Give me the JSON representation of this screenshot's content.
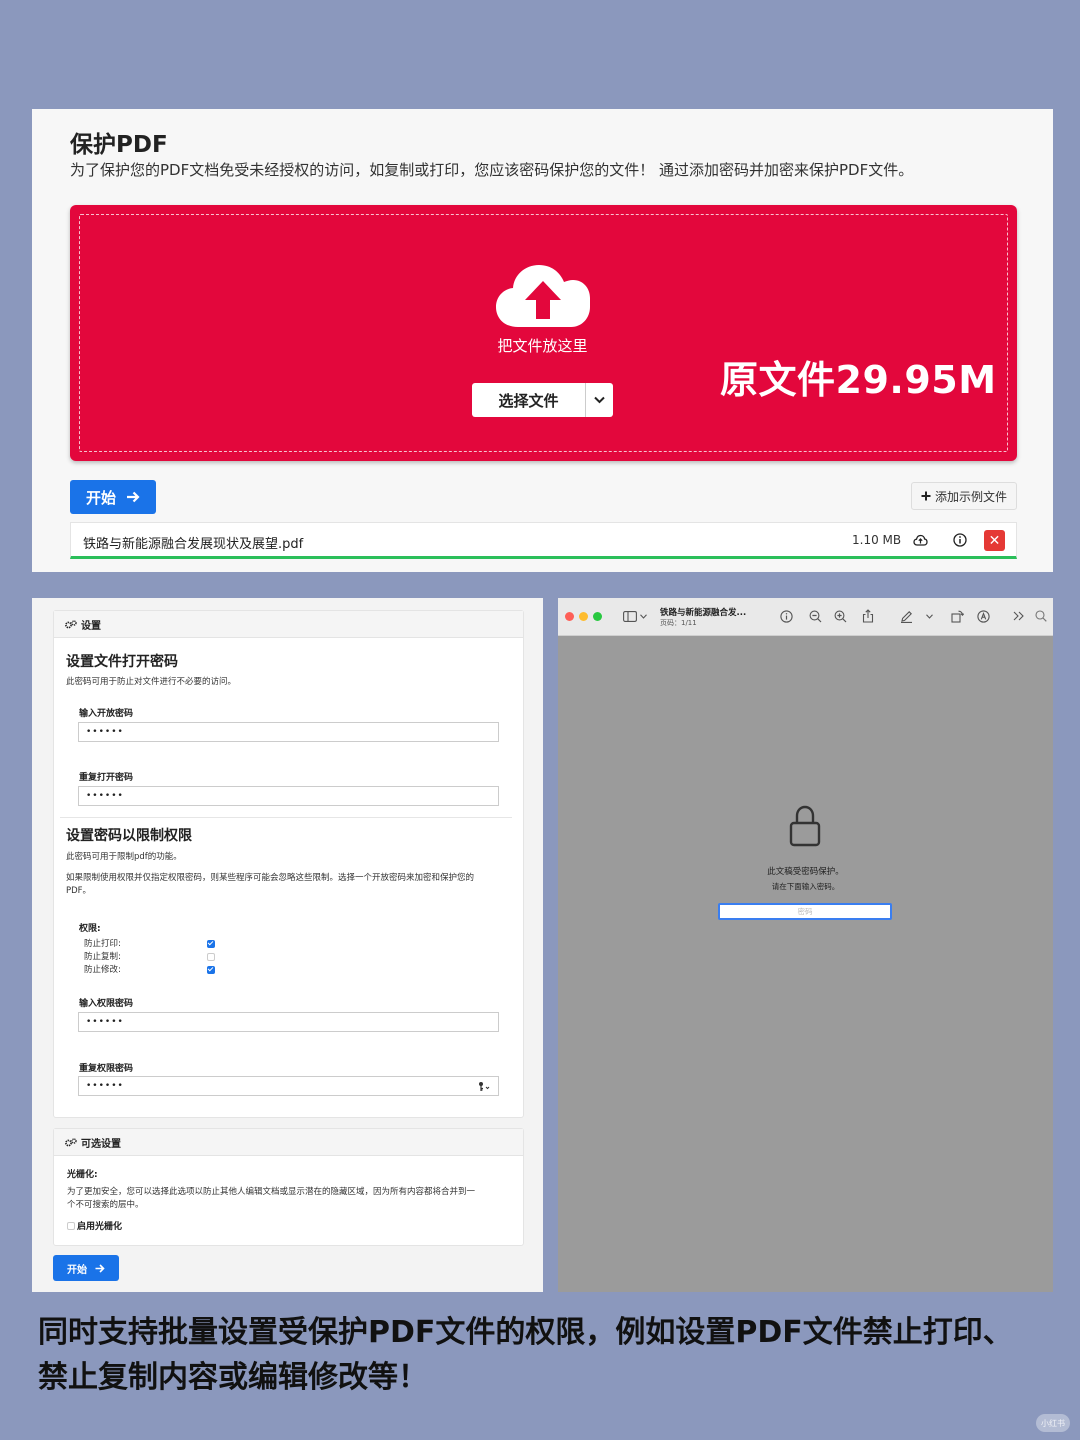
{
  "top": {
    "title": "保护PDF",
    "description": "为了保护您的PDF文档免受未经授权的访问，如复制或打印，您应该密码保护您的文件！ 通过添加密码并加密来保护PDF文件。",
    "drop_text": "把文件放这里",
    "select_button": "选择文件",
    "overlay_text": "原文件29.95M",
    "start_button": "开始",
    "add_sample_button": "添加示例文件",
    "file": {
      "name": "铁路与新能源融合发展现状及展望.pdf",
      "size": "1.10 MB",
      "progress": 1.0
    },
    "colors": {
      "dropzone": "#e3073c",
      "primary": "#1a73e8",
      "progress": "#2bbf5a",
      "remove": "#e53935"
    }
  },
  "settings": {
    "header": "设置",
    "open_password": {
      "title": "设置文件打开密码",
      "desc": "此密码可用于防止对文件进行不必要的访问。",
      "input_label": "输入开放密码",
      "input_value": "••••••",
      "repeat_label": "重复打开密码",
      "repeat_value": "••••••"
    },
    "permission_password": {
      "title": "设置密码以限制权限",
      "desc1": "此密码可用于限制pdf的功能。",
      "desc2_line1": "如果限制使用权限并仅指定权限密码，则某些程序可能会忽略这些限制。选择一个开放密码来加密和保护您的",
      "desc2_line2": "PDF。",
      "permissions_label": "权限:",
      "permissions": [
        {
          "label": "防止打印:",
          "checked": true
        },
        {
          "label": "防止复制:",
          "checked": false
        },
        {
          "label": "防止修改:",
          "checked": true
        }
      ],
      "input_label": "输入权限密码",
      "input_value": "••••••",
      "repeat_label": "重复权限密码",
      "repeat_value": "••••••"
    },
    "optional": {
      "header": "可选设置",
      "rasterize_label": "光栅化:",
      "rasterize_desc1": "为了更加安全，您可以选择此选项以防止其他人编辑文档或显示潜在的隐藏区域，因为所有内容都将合并到一",
      "rasterize_desc2": "个不可搜索的层中。",
      "enable_label": "启用光栅化",
      "enable_checked": false
    },
    "start_button": "开始"
  },
  "preview": {
    "window_title": "铁路与新能源融合发...",
    "page_info": "页码：1/11",
    "message1": "此文稿受密码保护。",
    "message2": "请在下面输入密码。",
    "password_placeholder": "密码"
  },
  "caption": {
    "line1": "同时支持批量设置受保护PDF文件的权限，例如设置PDF文件禁止打印、",
    "line2": "禁止复制内容或编辑修改等！"
  },
  "watermark": "小红书"
}
